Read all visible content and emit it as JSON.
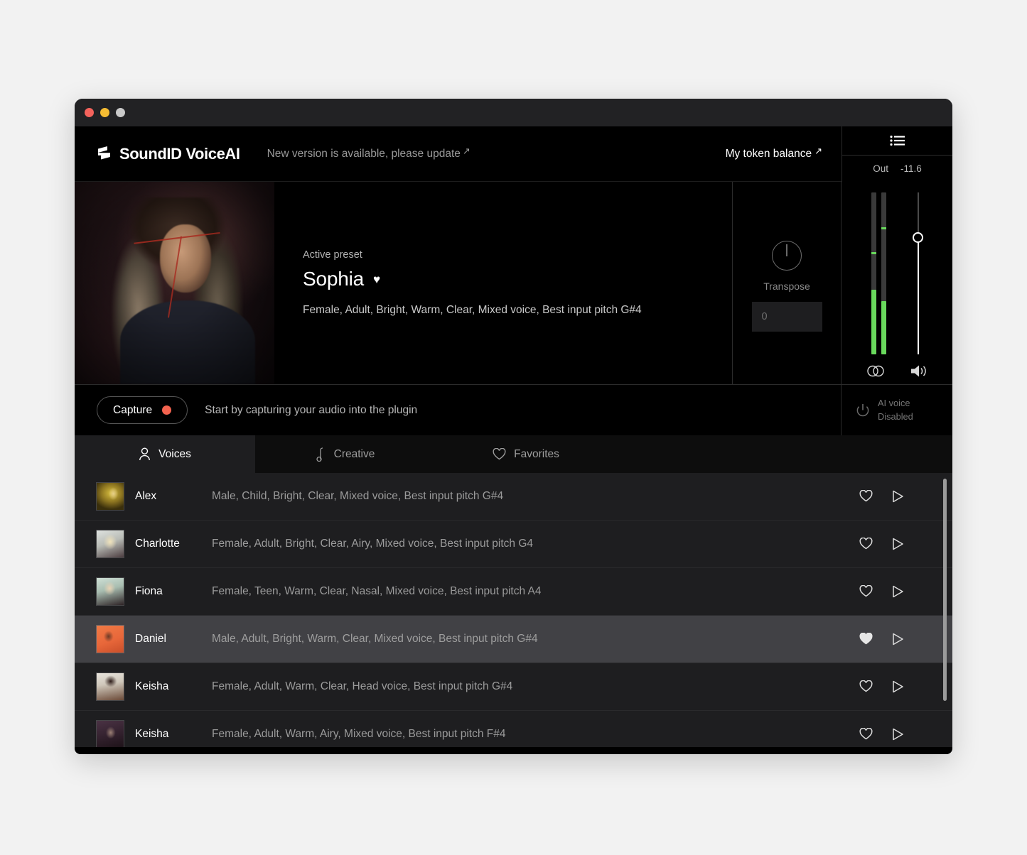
{
  "window": {
    "traffic_lights": [
      "close",
      "minimize",
      "maximize"
    ]
  },
  "header": {
    "brand": "SoundID VoiceAI",
    "logo_icon": "soundid-logo-icon",
    "update_message": "New version is available, please update",
    "update_arrow": "↗",
    "token_balance": "My token balance",
    "token_arrow": "↗",
    "list_icon": "list-icon",
    "out_label": "Out",
    "out_value": "-11.6"
  },
  "hero": {
    "portrait_alt": "sophia-portrait",
    "active_preset_label": "Active preset",
    "preset_name": "Sophia",
    "preset_favorite_icon": "heart-filled-icon",
    "preset_tags": "Female, Adult, Bright, Warm, Clear, Mixed voice, Best input pitch  G#4"
  },
  "transpose": {
    "knob_icon": "knob-icon",
    "label": "Transpose",
    "value": "0"
  },
  "meter": {
    "stereo_link_icon": "stereo-link-icon",
    "speaker_icon": "speaker-icon",
    "bars": [
      {
        "fill_percent": 40,
        "peak_percent": 62
      },
      {
        "fill_percent": 33,
        "peak_percent": 77
      }
    ],
    "fader_percent": 72
  },
  "capture": {
    "button_label": "Capture",
    "record_dot_color": "#f4634f",
    "hint": "Start by capturing your audio into the plugin",
    "power_icon": "power-icon",
    "ai_voice_label": "AI voice",
    "ai_voice_state": "Disabled"
  },
  "tabs": [
    {
      "label": "Voices",
      "icon": "person-icon",
      "active": true
    },
    {
      "label": "Creative",
      "icon": "music-note-icon",
      "active": false
    },
    {
      "label": "Favorites",
      "icon": "heart-outline-icon",
      "active": false
    }
  ],
  "voices": [
    {
      "name": "Alex",
      "tags": "Male, Child, Bright, Clear, Mixed voice, Best input pitch G#4",
      "favorite": false,
      "selected": false,
      "avatar": "alex-avatar"
    },
    {
      "name": "Charlotte",
      "tags": "Female, Adult, Bright, Clear, Airy, Mixed voice, Best input pitch  G4",
      "favorite": false,
      "selected": false,
      "avatar": "charlotte-avatar"
    },
    {
      "name": "Fiona",
      "tags": "Female, Teen, Warm, Clear, Nasal, Mixed voice, Best input pitch  A4",
      "favorite": false,
      "selected": false,
      "avatar": "fiona-avatar"
    },
    {
      "name": "Daniel",
      "tags": "Male, Adult, Bright, Warm, Clear, Mixed voice, Best input pitch  G#4",
      "favorite": true,
      "selected": true,
      "avatar": "daniel-avatar"
    },
    {
      "name": "Keisha",
      "tags": "Female, Adult, Warm, Clear, Head voice, Best input pitch  G#4",
      "favorite": false,
      "selected": false,
      "avatar": "keisha-1-avatar"
    },
    {
      "name": "Keisha",
      "tags": "Female, Adult, Warm, Airy, Mixed voice, Best input pitch  F#4",
      "favorite": false,
      "selected": false,
      "avatar": "keisha-2-avatar"
    }
  ],
  "row_icons": {
    "favorite_icon": "heart-icon",
    "play_icon": "play-icon"
  },
  "colors": {
    "accent_green": "#69d95c",
    "record_red": "#f4634f",
    "panel_bg": "#000000",
    "row_bg": "#1e1e20",
    "row_selected_bg": "#414145"
  }
}
